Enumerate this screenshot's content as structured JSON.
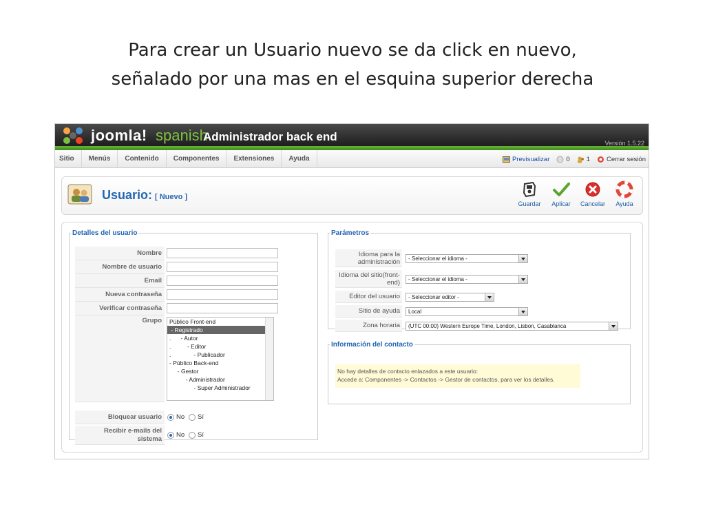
{
  "slide": {
    "title_line1": "Para crear un Usuario nuevo se da click en nuevo,",
    "title_line2": "señalado por una mas en el esquina superior derecha"
  },
  "header": {
    "logo_text": "joomla!",
    "logo_sub": "spanish",
    "title": "Administrador back end",
    "version": "Versión 1.5.22"
  },
  "menu": [
    "Sitio",
    "Menús",
    "Contenido",
    "Componentes",
    "Extensiones",
    "Ayuda"
  ],
  "status": {
    "preview": "Previsualizar",
    "messages": "0",
    "users": "1",
    "logout": "Cerrar sesión"
  },
  "toolbar": {
    "title": "Usuario:",
    "subtitle": "[ Nuevo ]",
    "save": "Guardar",
    "apply": "Aplicar",
    "cancel": "Cancelar",
    "help": "Ayuda"
  },
  "user_details": {
    "legend": "Detalles del usuario",
    "name_label": "Nombre",
    "username_label": "Nombre de usuario",
    "email_label": "Email",
    "new_password_label": "Nueva contraseña",
    "verify_password_label": "Verificar contraseña",
    "group_label": "Grupo",
    "groups": [
      "Público Front-end",
      " - Registrado",
      ".      - Autor",
      ".          - Editor",
      ".              - Publicador",
      "- Público Back-end",
      "     - Gestor",
      "          - Administrador",
      "               - Super Administrador"
    ],
    "selected_group": " - Registrado",
    "block_label": "Bloquear usuario",
    "email_sys_label_1": "Recibir e-mails del",
    "email_sys_label_2": "sistema",
    "no": "No",
    "yes": "Sí"
  },
  "params": {
    "legend": "Parámetros",
    "admin_lang_label": "Idioma para la administración",
    "admin_lang_value": "- Seleccionar el idioma -",
    "site_lang_label": "Idioma del sitio(front-end)",
    "site_lang_value": "- Seleccionar el idioma -",
    "editor_label": "Editor del usuario",
    "editor_value": "- Seleccionar editor -",
    "help_site_label": "Sitio de ayuda",
    "help_site_value": "Local",
    "timezone_label": "Zona horaria",
    "timezone_value": "(UTC 00:00) Western Europe Time, London, Lisbon, Casablanca"
  },
  "contact": {
    "legend": "Información del contacto",
    "line1": "No hay detalles de contacto enlazados a este usuario:",
    "line2": "Accede a: Componentes -> Contactos -> Gestor de contactos, para ver los detalles."
  },
  "colors": {
    "accent_blue": "#2566b3",
    "header_dark": "#1e1e1e",
    "green": "#5aa52e"
  }
}
